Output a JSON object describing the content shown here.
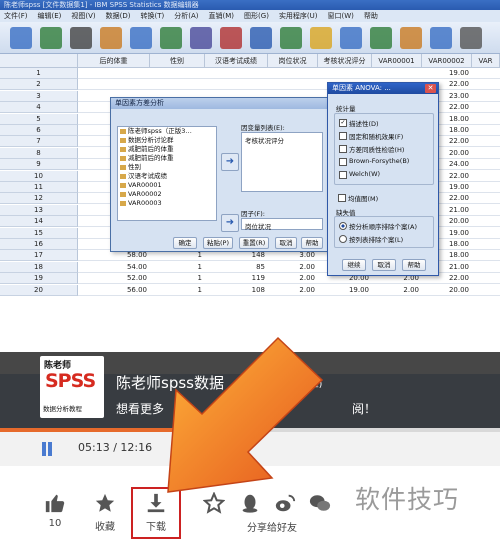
{
  "spss": {
    "title": "陈老师spss  [文件数据集1] - IBM SPSS Statistics 数据编辑器",
    "menus": [
      "文件(F)",
      "编辑(E)",
      "视图(V)",
      "数据(D)",
      "转换(T)",
      "分析(A)",
      "直销(M)",
      "图形(G)",
      "实用程序(U)",
      "窗口(W)",
      "帮助"
    ],
    "columns": [
      "后的体重",
      "性别",
      "汉语考试成绩",
      "岗位状况",
      "考核状况评分",
      "VAR00001",
      "VAR00002",
      "VAR"
    ],
    "rows": [
      {
        "n": "1",
        "c": [
          "",
          "",
          "",
          "",
          "",
          "",
          "19.00",
          ""
        ]
      },
      {
        "n": "2",
        "c": [
          "",
          "",
          "",
          "",
          "",
          "",
          "22.00",
          ""
        ]
      },
      {
        "n": "3",
        "c": [
          "",
          "",
          "",
          "",
          "",
          "",
          "23.00",
          ""
        ]
      },
      {
        "n": "4",
        "c": [
          "",
          "",
          "",
          "",
          "",
          "",
          "22.00",
          ""
        ]
      },
      {
        "n": "5",
        "c": [
          "",
          "",
          "",
          "",
          "",
          "",
          "18.00",
          ""
        ]
      },
      {
        "n": "6",
        "c": [
          "",
          "",
          "",
          "",
          "",
          "",
          "18.00",
          ""
        ]
      },
      {
        "n": "7",
        "c": [
          "",
          "",
          "",
          "",
          "",
          "",
          "22.00",
          ""
        ]
      },
      {
        "n": "8",
        "c": [
          "",
          "",
          "",
          "",
          "",
          "",
          "20.00",
          ""
        ]
      },
      {
        "n": "9",
        "c": [
          "",
          "",
          "",
          "",
          "",
          "",
          "24.00",
          ""
        ]
      },
      {
        "n": "10",
        "c": [
          "",
          "",
          "",
          "",
          "",
          "",
          "22.00",
          ""
        ]
      },
      {
        "n": "11",
        "c": [
          "",
          "",
          "",
          "",
          "",
          "",
          "19.00",
          ""
        ]
      },
      {
        "n": "12",
        "c": [
          "",
          "",
          "",
          "",
          "",
          "",
          "22.00",
          ""
        ]
      },
      {
        "n": "13",
        "c": [
          "54.00",
          "1",
          "",
          "",
          "",
          "",
          "21.00",
          ""
        ]
      },
      {
        "n": "14",
        "c": [
          "55.00",
          "1",
          "127",
          "3.00",
          "",
          "",
          "20.00",
          ""
        ]
      },
      {
        "n": "15",
        "c": [
          "59.00",
          "1",
          "134",
          "3.00",
          "",
          "",
          "19.00",
          ""
        ]
      },
      {
        "n": "16",
        "c": [
          "59.00",
          "1",
          "148",
          "3.00",
          "18.00",
          "3.00",
          "18.00",
          ""
        ]
      },
      {
        "n": "17",
        "c": [
          "58.00",
          "1",
          "148",
          "3.00",
          "21.00",
          "3.00",
          "18.00",
          ""
        ]
      },
      {
        "n": "18",
        "c": [
          "54.00",
          "1",
          "85",
          "2.00",
          "21.00",
          "2.00",
          "21.00",
          ""
        ]
      },
      {
        "n": "19",
        "c": [
          "52.00",
          "1",
          "119",
          "2.00",
          "20.00",
          "2.00",
          "22.00",
          ""
        ]
      },
      {
        "n": "20",
        "c": [
          "56.00",
          "1",
          "108",
          "2.00",
          "19.00",
          "2.00",
          "20.00",
          ""
        ]
      }
    ],
    "oneway": {
      "title": "单因素方差分析",
      "vars": [
        "陈老师spss（正版3…",
        "数据分析讨论群",
        "减肥前后的体重",
        "减肥前后的体重",
        "性别",
        "汉语考试成绩",
        "VAR00001",
        "VAR00002",
        "VAR00003"
      ],
      "dep_label": "因变量列表(E):",
      "dep_item": "考核状况评分",
      "factor_label": "因子(F):",
      "factor_item": "岗位状况",
      "buttons": [
        "确定",
        "粘贴(P)",
        "重置(R)",
        "取消",
        "帮助"
      ]
    },
    "options": {
      "title": "单因素 ANOVA: ...",
      "stats_label": "统计量",
      "stats": [
        "描述性(D)",
        "固定和随机效果(F)",
        "方差同质性检验(H)",
        "Brown-Forsythe(B)",
        "Welch(W)"
      ],
      "plot": "均值图(M)",
      "missing_label": "缺失值",
      "missing": [
        "按分析顺序排除个案(A)",
        "按列表排除个案(L)"
      ],
      "buttons": [
        "继续",
        "取消",
        "帮助"
      ]
    }
  },
  "channel": {
    "logo_top": "陈老师",
    "logo_main": "SPSS",
    "logo_bottom": "数据分析教程",
    "name": "陈老师spss数据",
    "fans": "(942粉丝)",
    "subtitle_left": "想看更多",
    "subtitle_mid": "师",
    "subtitle_right": "阅！"
  },
  "player": {
    "time": "05:13 / 12:16",
    "progress": 0.425
  },
  "actions": {
    "like_count": "10",
    "favorite": "收藏",
    "download": "下载",
    "share": "分享给好友"
  },
  "watermark": "软件技巧",
  "colors": {
    "accent_orange": "#e66a2c",
    "highlight_red": "#cc2222",
    "spss_red": "#d62b20"
  }
}
